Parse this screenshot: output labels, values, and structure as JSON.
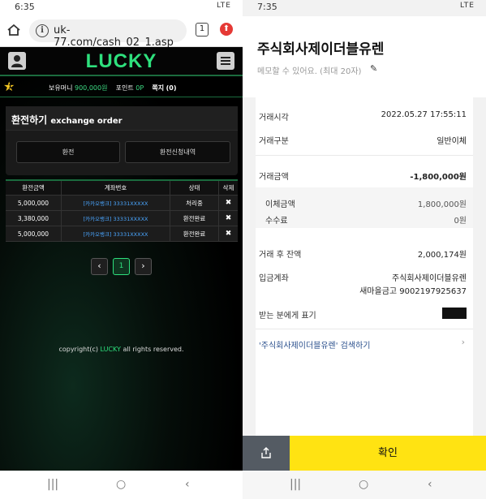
{
  "left": {
    "status_time": "6:35",
    "status_icons": "LTE",
    "url": "uk-77.com/cash_02_1.asp",
    "tab_count": "1",
    "logo": "LUCKY",
    "level_badge": "1",
    "balance_label": "보유머니",
    "balance_value": "900,000원",
    "points_label": "포인트",
    "points_value": "0P",
    "messages_label": "쪽지",
    "messages_value": "(0)",
    "panel_title": "환전하기",
    "panel_title_en": "exchange order",
    "btn_exchange": "환전",
    "btn_history": "환전신청내역",
    "table_headers": [
      "환전금액",
      "계좌번호",
      "상태",
      "삭제"
    ],
    "rows": [
      {
        "amount": "5,000,000",
        "account": "[카카오뱅크] 33331XXXXX",
        "status": "처리중"
      },
      {
        "amount": "3,380,000",
        "account": "[카카오뱅크] 33331XXXXX",
        "status": "환전완료"
      },
      {
        "amount": "5,000,000",
        "account": "[카카오뱅크] 33331XXXXX",
        "status": "환전완료"
      }
    ],
    "delete_symbol": "✖",
    "pager_prev": "‹",
    "pager_page": "1",
    "pager_next": "›",
    "copyright_prefix": "copyright(c)",
    "copyright_brand": "LUCKY",
    "copyright_suffix": "all rights reserved.",
    "nav": [
      "|||",
      "○",
      "‹"
    ]
  },
  "right": {
    "status_time": "7:35",
    "status_icons": "LTE",
    "title": "주식회사제이더블유렌",
    "memo_placeholder": "메모할 수 있어요. (최대 20자)",
    "fields": {
      "datetime_label": "거래시각",
      "datetime_value": "2022.05.27 17:55:11",
      "type_label": "거래구분",
      "type_value": "일반이체",
      "amount_label": "거래금액",
      "amount_value": "-1,800,000원",
      "transfer_label": "이체금액",
      "transfer_value": "1,800,000원",
      "fee_label": "수수료",
      "fee_value": "0원",
      "balance_label": "거래 후 잔액",
      "balance_value": "2,000,174원",
      "account_label": "입금계좌",
      "account_name": "주식회사제이더블유렌",
      "account_bank": "새마을금고 9002197925637",
      "recipient_label": "받는 분에게 표기"
    },
    "search_link": "'주식회사제이더블유렌' 검색하기",
    "confirm": "확인",
    "nav": [
      "|||",
      "○",
      "‹"
    ]
  }
}
